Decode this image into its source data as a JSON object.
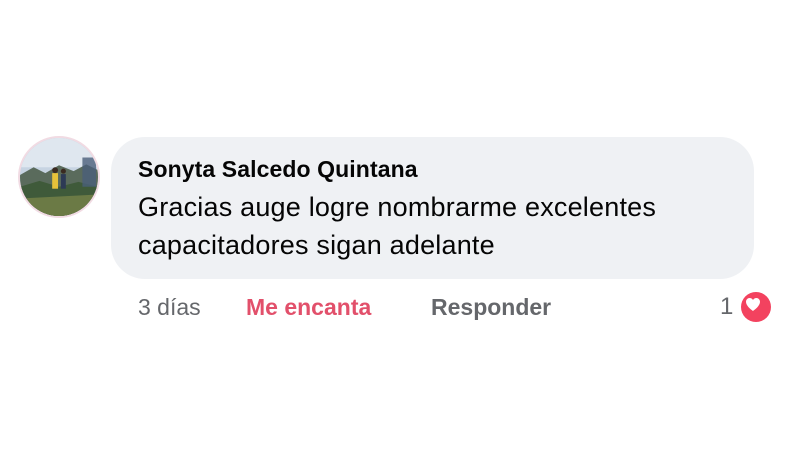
{
  "comment": {
    "author": "Sonyta Salcedo Quintana",
    "text_line_1": "Gracias auge logre nombrarme excelentes",
    "text_line_2": "capacitadores sigan adelante",
    "timestamp": "3 días",
    "love_label": "Me encanta",
    "reply_label": "Responder",
    "reaction_count": "1",
    "reaction_icon": "heart-icon",
    "avatar": "profile-photo"
  },
  "colors": {
    "bubble_bg": "#eff1f4",
    "love_active": "#e2506b",
    "meta_text": "#65676b",
    "heart": "#f3425f"
  }
}
